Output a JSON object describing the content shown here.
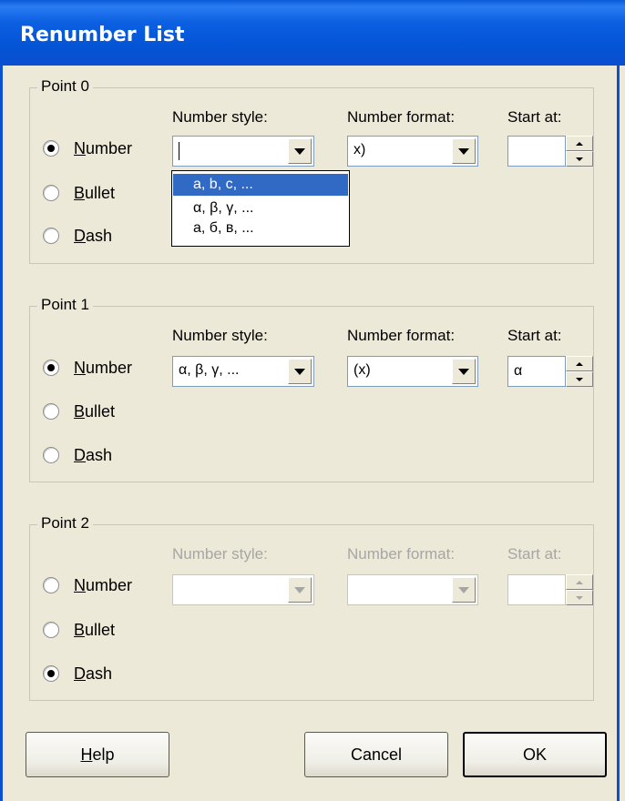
{
  "window": {
    "title": "Renumber List"
  },
  "groups": [
    {
      "legend": "Point 0",
      "radios": [
        {
          "accel": "N",
          "rest": "umber",
          "checked": true
        },
        {
          "accel": "B",
          "rest": "ullet",
          "checked": false
        },
        {
          "accel": "D",
          "rest": "ash",
          "checked": false
        }
      ],
      "number_style_label": "Number style:",
      "number_style_value": "",
      "number_format_label": "Number format:",
      "number_format_value": "x)",
      "start_at_label": "Start at:",
      "start_at_value": ""
    },
    {
      "legend": "Point 1",
      "radios": [
        {
          "accel": "N",
          "rest": "umber",
          "checked": true
        },
        {
          "accel": "B",
          "rest": "ullet",
          "checked": false
        },
        {
          "accel": "D",
          "rest": "ash",
          "checked": false
        }
      ],
      "number_style_label": "Number style:",
      "number_style_value": "α, β, γ, ...",
      "number_format_label": "Number format:",
      "number_format_value": "(x)",
      "start_at_label": "Start at:",
      "start_at_value": "α"
    },
    {
      "legend": "Point 2",
      "radios": [
        {
          "accel": "N",
          "rest": "umber",
          "checked": false
        },
        {
          "accel": "B",
          "rest": "ullet",
          "checked": false
        },
        {
          "accel": "D",
          "rest": "ash",
          "checked": true
        }
      ],
      "number_style_label": "Number style:",
      "number_style_value": "",
      "number_format_label": "Number format:",
      "number_format_value": "",
      "start_at_label": "Start at:",
      "start_at_value": ""
    }
  ],
  "dropdown_options": [
    "a, b, c, ...",
    "α, β, γ, ...",
    "а, б, в, ..."
  ],
  "buttons": {
    "help_accel": "H",
    "help_rest": "elp",
    "cancel": "Cancel",
    "ok": "OK"
  },
  "colors": {
    "title_bar": "#0a5ad8",
    "selection": "#316ac5",
    "dialog_bg": "#ece9d8"
  }
}
